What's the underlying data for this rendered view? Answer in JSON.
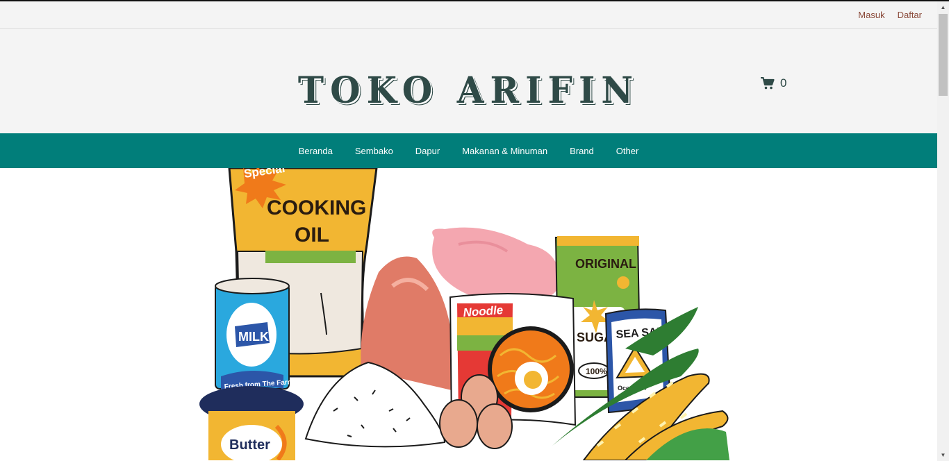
{
  "topbar": {
    "login": "Masuk",
    "register": "Daftar"
  },
  "header": {
    "brand": "TOKO ARIFIN",
    "cart_count": "0"
  },
  "nav": {
    "items": [
      "Beranda",
      "Sembako",
      "Dapur",
      "Makanan & Minuman",
      "Brand",
      "Other"
    ]
  },
  "hero": {
    "oil_special": "Special",
    "oil_line1": "COOKING",
    "oil_line2": "OIL",
    "milk_label": "MILK",
    "milk_tagline": "Fresh from The Farm",
    "butter_label": "Butter",
    "noodle_label": "Noodle",
    "sugar_brand": "ORIGINAL",
    "sugar_label": "SUGAR",
    "sugar_percent": "100%",
    "salt_label": "SEA SALT",
    "salt_sub": "Ocean Tri"
  },
  "colors": {
    "nav_bg": "#017e7a",
    "brand": "#2f4a47",
    "link": "#8a4a3a"
  }
}
